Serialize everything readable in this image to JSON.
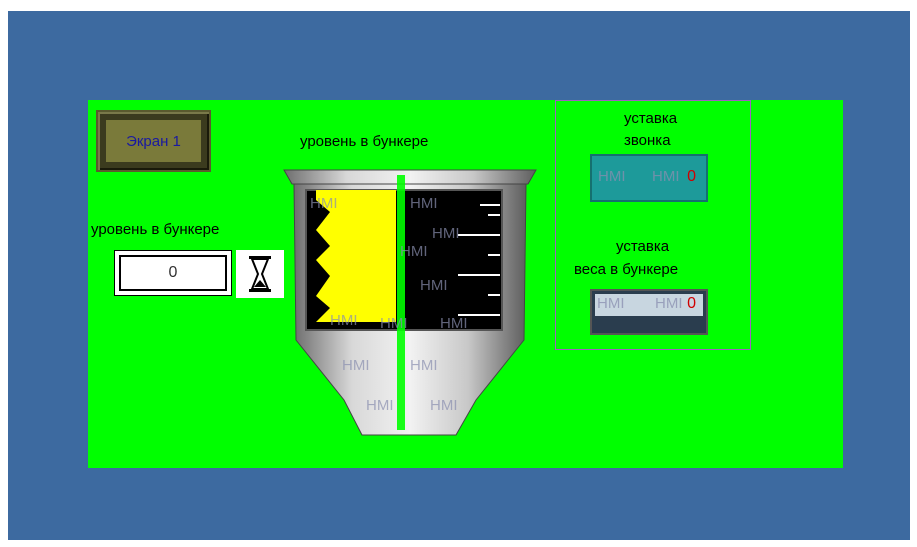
{
  "screen_button": {
    "label": "Экран 1"
  },
  "hopper": {
    "title": "уровень в бункере",
    "fill_level": 0.72
  },
  "level_display": {
    "label": "уровень в бункере",
    "value": "0"
  },
  "bell_setpoint": {
    "label_line1": "уставка",
    "label_line2": "звонка",
    "value": "0"
  },
  "weight_setpoint": {
    "label_line1": "уставка",
    "label_line2": "веса в бункере",
    "value": "0"
  },
  "watermark": "HMI",
  "colors": {
    "background": "#3d6aa0",
    "panel": "#00ff00",
    "fill": "#ffff00",
    "value_text": "#d00000"
  }
}
